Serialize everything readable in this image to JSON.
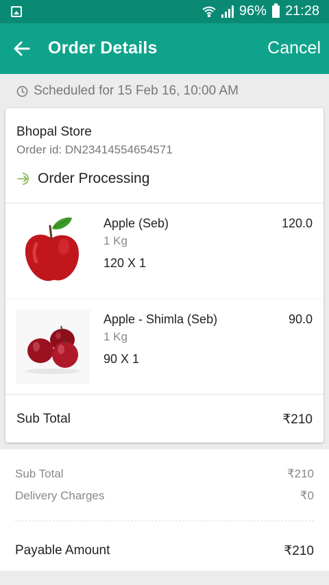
{
  "status_bar": {
    "battery": "96%",
    "time": "21:28",
    "icons": [
      "gallery-icon",
      "wifi-icon",
      "signal-icon",
      "battery-icon"
    ]
  },
  "app_bar": {
    "title": "Order Details",
    "cancel_label": "Cancel",
    "back_icon": "back-arrow-icon",
    "color": "#0fa38b"
  },
  "schedule": {
    "text": "Scheduled for 15 Feb 16, 10:00 AM",
    "icon": "clock-icon"
  },
  "order": {
    "store_name": "Bhopal Store",
    "order_id": "Order id: DN23414554654571",
    "status": "Order Processing",
    "status_icon": "processing-arrow-icon",
    "status_color": "#7cb342",
    "items": [
      {
        "name": "Apple (Seb)",
        "unit": "1 Kg",
        "qty": "120 X 1",
        "price": "120.0",
        "image": "red-apple-with-leaf"
      },
      {
        "name": "Apple - Shimla (Seb)",
        "unit": "1 Kg",
        "qty": "90 X 1",
        "price": "90.0",
        "image": "shimla-apples-group"
      }
    ],
    "sub_total_label": "Sub Total",
    "sub_total_value": "₹210"
  },
  "summary": {
    "sub_total_label": "Sub Total",
    "sub_total_value": "₹210",
    "delivery_label": "Delivery Charges",
    "delivery_value": "₹0",
    "payable_label": "Payable Amount",
    "payable_value": "₹210"
  }
}
